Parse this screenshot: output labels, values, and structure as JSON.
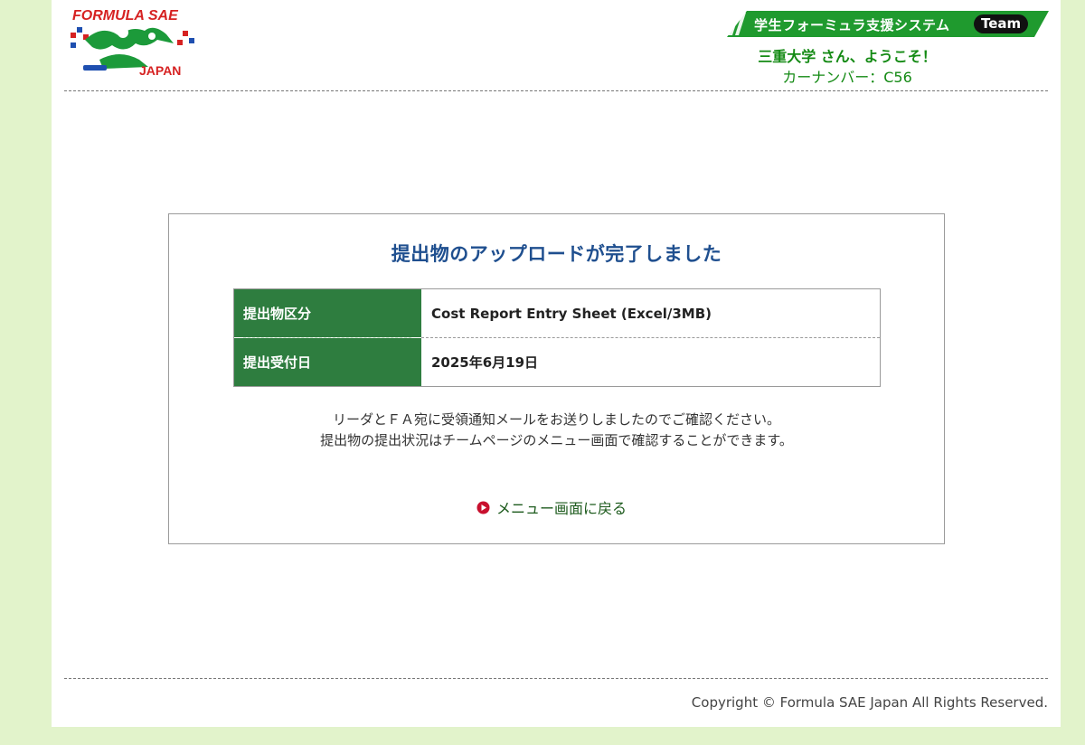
{
  "logo": {
    "top_text": "FORMULA SAE",
    "bottom_text": "JAPAN"
  },
  "header": {
    "system_name": "学生フォーミュラ支援システム",
    "badge": "Team",
    "school_name": "三重大学",
    "welcome_suffix": " さん、ようこそ！",
    "car_number": "カーナンバー：C56"
  },
  "main": {
    "title": "提出物のアップロードが完了しました",
    "rows": [
      {
        "label": "提出物区分",
        "value": "Cost Report Entry Sheet (Excel/3MB)"
      },
      {
        "label": "提出受付日",
        "value": "2025年6月19日"
      }
    ],
    "message_lines": [
      "リーダとＦＡ宛に受領通知メールをお送りしましたのでご確認ください。",
      "提出物の提出状況はチームページのメニュー画面で確認することができます。"
    ],
    "back_link": "メニュー画面に戻る"
  },
  "footer": {
    "copyright": "Copyright © Formula SAE Japan All Rights Reserved."
  },
  "colors": {
    "page_background": "#e2f3cb",
    "brand_green": "#148a14",
    "table_header": "#2e7d3f",
    "title_blue": "#1f4f8f",
    "link_icon_red": "#c8102e"
  }
}
